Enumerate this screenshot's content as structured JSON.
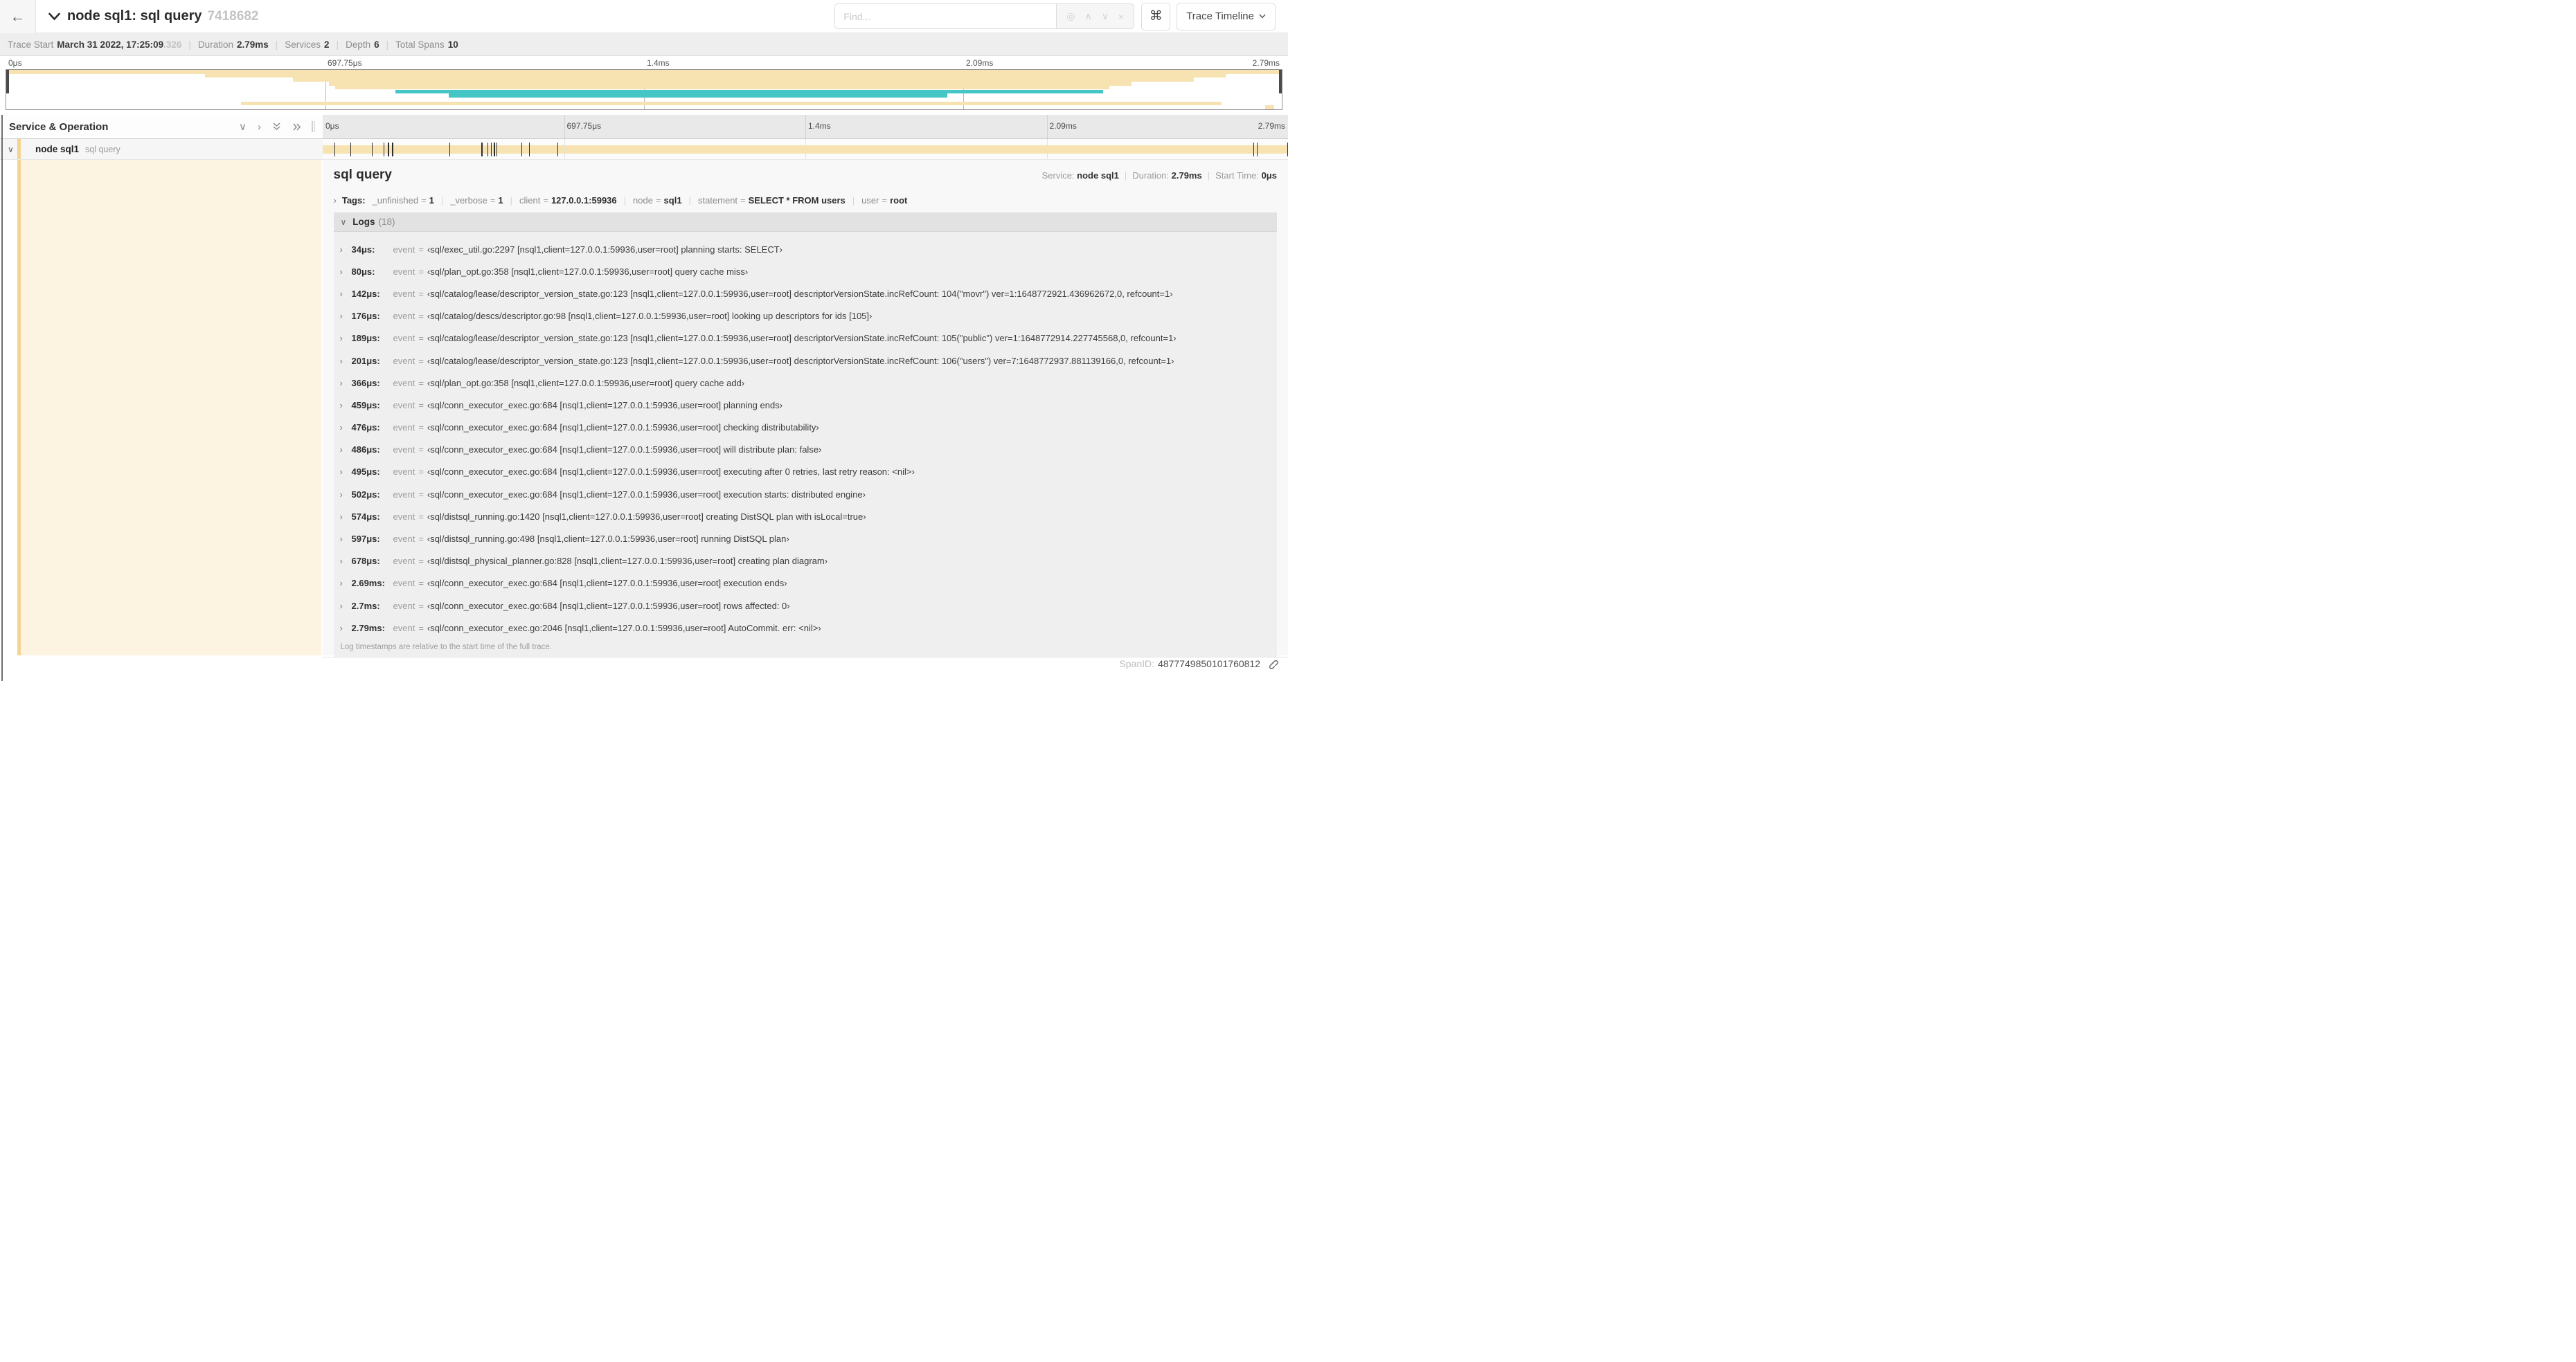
{
  "header": {
    "back_icon": "←",
    "title": "node sql1: sql query",
    "trace_id": "7418682",
    "find_placeholder": "Find...",
    "shortcut_button": "⌘",
    "view_label": "Trace Timeline"
  },
  "find_icons": {
    "locate": "◎",
    "prev": "∧",
    "next": "∨",
    "clear": "×"
  },
  "summary": {
    "items": [
      {
        "label": "Trace Start",
        "value": "March 31 2022, 17:25:09",
        "suffix": ".326"
      },
      {
        "label": "Duration",
        "value": "2.79ms"
      },
      {
        "label": "Services",
        "value": "2"
      },
      {
        "label": "Depth",
        "value": "6"
      },
      {
        "label": "Total Spans",
        "value": "10"
      }
    ],
    "separator": "|"
  },
  "timeline": {
    "left_header": "Service & Operation",
    "ticks": [
      {
        "label": "0μs",
        "pos": 0
      },
      {
        "label": "697.75μs",
        "pos": 25
      },
      {
        "label": "1.4ms",
        "pos": 50
      },
      {
        "label": "2.09ms",
        "pos": 75
      },
      {
        "label": "2.79ms",
        "pos": 100
      }
    ],
    "gridlines": [
      25,
      50,
      75
    ]
  },
  "minimap": {
    "bars": [
      {
        "row": 0,
        "start": 0,
        "end": 100,
        "color": "tan"
      },
      {
        "row": 1,
        "start": 15.6,
        "end": 95.6,
        "color": "tan"
      },
      {
        "row": 2,
        "start": 22.5,
        "end": 93.1,
        "color": "tan"
      },
      {
        "row": 3,
        "start": 25.3,
        "end": 88.2,
        "color": "tan"
      },
      {
        "row": 4,
        "start": 25.8,
        "end": 86.5,
        "color": "tan"
      },
      {
        "row": 5,
        "start": 30.5,
        "end": 86.0,
        "color": "teal"
      },
      {
        "row": 6,
        "start": 34.7,
        "end": 73.8,
        "color": "teal"
      },
      {
        "row": 8,
        "start": 18.4,
        "end": 95.3,
        "color": "tan"
      },
      {
        "row": 9,
        "start": 98.7,
        "end": 99.4,
        "color": "tan"
      }
    ]
  },
  "span_row": {
    "service": "node sql1",
    "operation": "sql query",
    "duration_ms": 2.79,
    "log_times_ms": [
      0.034,
      0.08,
      0.142,
      0.176,
      0.189,
      0.201,
      0.366,
      0.459,
      0.476,
      0.486,
      0.495,
      0.502,
      0.574,
      0.597,
      0.678,
      2.69,
      2.7,
      2.79
    ]
  },
  "detail": {
    "title": "sql query",
    "meta": [
      {
        "label": "Service:",
        "value": "node sql1"
      },
      {
        "label": "Duration:",
        "value": "2.79ms"
      },
      {
        "label": "Start Time:",
        "value": "0μs"
      }
    ],
    "tags_label": "Tags:",
    "tags": [
      {
        "key": "_unfinished",
        "value": "1"
      },
      {
        "key": "_verbose",
        "value": "1"
      },
      {
        "key": "client",
        "value": "127.0.0.1:59936"
      },
      {
        "key": "node",
        "value": "sql1"
      },
      {
        "key": "statement",
        "value": "SELECT * FROM users"
      },
      {
        "key": "user",
        "value": "root"
      }
    ],
    "kv_separator": "=",
    "item_separator": "|",
    "logs_label": "Logs",
    "logs_count": "(18)",
    "logs": [
      {
        "time": "34μs:",
        "field": "event",
        "value": "‹sql/exec_util.go:2297 [nsql1,client=127.0.0.1:59936,user=root] planning starts: SELECT›"
      },
      {
        "time": "80μs:",
        "field": "event",
        "value": "‹sql/plan_opt.go:358 [nsql1,client=127.0.0.1:59936,user=root] query cache miss›"
      },
      {
        "time": "142μs:",
        "field": "event",
        "value": "‹sql/catalog/lease/descriptor_version_state.go:123 [nsql1,client=127.0.0.1:59936,user=root] descriptorVersionState.incRefCount: 104(\"movr\") ver=1:1648772921.436962672,0, refcount=1›"
      },
      {
        "time": "176μs:",
        "field": "event",
        "value": "‹sql/catalog/descs/descriptor.go:98 [nsql1,client=127.0.0.1:59936,user=root] looking up descriptors for ids [105]›"
      },
      {
        "time": "189μs:",
        "field": "event",
        "value": "‹sql/catalog/lease/descriptor_version_state.go:123 [nsql1,client=127.0.0.1:59936,user=root] descriptorVersionState.incRefCount: 105(\"public\") ver=1:1648772914.227745568,0, refcount=1›"
      },
      {
        "time": "201μs:",
        "field": "event",
        "value": "‹sql/catalog/lease/descriptor_version_state.go:123 [nsql1,client=127.0.0.1:59936,user=root] descriptorVersionState.incRefCount: 106(\"users\") ver=7:1648772937.881139166,0, refcount=1›"
      },
      {
        "time": "366μs:",
        "field": "event",
        "value": "‹sql/plan_opt.go:358 [nsql1,client=127.0.0.1:59936,user=root] query cache add›"
      },
      {
        "time": "459μs:",
        "field": "event",
        "value": "‹sql/conn_executor_exec.go:684 [nsql1,client=127.0.0.1:59936,user=root] planning ends›"
      },
      {
        "time": "476μs:",
        "field": "event",
        "value": "‹sql/conn_executor_exec.go:684 [nsql1,client=127.0.0.1:59936,user=root] checking distributability›"
      },
      {
        "time": "486μs:",
        "field": "event",
        "value": "‹sql/conn_executor_exec.go:684 [nsql1,client=127.0.0.1:59936,user=root] will distribute plan: false›"
      },
      {
        "time": "495μs:",
        "field": "event",
        "value": "‹sql/conn_executor_exec.go:684 [nsql1,client=127.0.0.1:59936,user=root] executing after 0 retries, last retry reason: <nil>›"
      },
      {
        "time": "502μs:",
        "field": "event",
        "value": "‹sql/conn_executor_exec.go:684 [nsql1,client=127.0.0.1:59936,user=root] execution starts: distributed engine›"
      },
      {
        "time": "574μs:",
        "field": "event",
        "value": "‹sql/distsql_running.go:1420 [nsql1,client=127.0.0.1:59936,user=root] creating DistSQL plan with isLocal=true›"
      },
      {
        "time": "597μs:",
        "field": "event",
        "value": "‹sql/distsql_running.go:498 [nsql1,client=127.0.0.1:59936,user=root] running DistSQL plan›"
      },
      {
        "time": "678μs:",
        "field": "event",
        "value": "‹sql/distsql_physical_planner.go:828 [nsql1,client=127.0.0.1:59936,user=root] creating plan diagram›"
      },
      {
        "time": "2.69ms:",
        "field": "event",
        "value": "‹sql/conn_executor_exec.go:684 [nsql1,client=127.0.0.1:59936,user=root] execution ends›"
      },
      {
        "time": "2.7ms:",
        "field": "event",
        "value": "‹sql/conn_executor_exec.go:684 [nsql1,client=127.0.0.1:59936,user=root] rows affected: 0›"
      },
      {
        "time": "2.79ms:",
        "field": "event",
        "value": "‹sql/conn_executor_exec.go:2046 [nsql1,client=127.0.0.1:59936,user=root] AutoCommit. err: <nil>›"
      }
    ],
    "logs_footnote": "Log timestamps are relative to the start time of the full trace.",
    "span_id_label": "SpanID:",
    "span_id": "4877749850101760812"
  },
  "colors": {
    "span_tan": "#F7E3B1",
    "span_teal": "#46C5C5",
    "accent": "#F4D492",
    "cream": "#FDF3E1"
  }
}
